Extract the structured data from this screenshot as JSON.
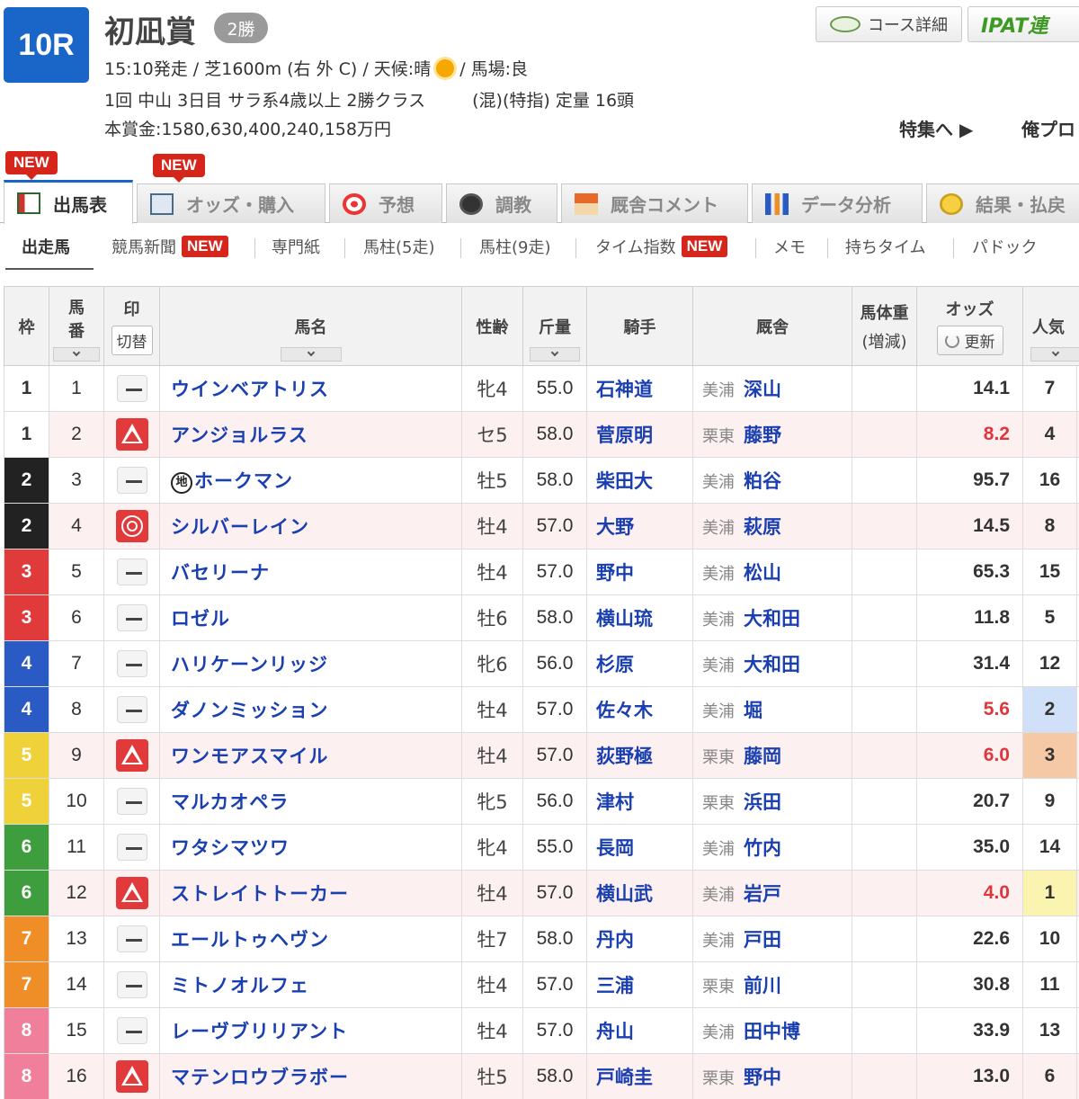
{
  "race": {
    "number": "10R",
    "name": "初凪賞",
    "grade": "2勝",
    "start_time": "15:10発走 / 芝1600m (右 外 C) / 天候:晴",
    "ground": "/ 馬場:良",
    "meeting": "1回 中山 3日目 サラ系4歳以上 2勝クラス",
    "conditions": "(混)(特指) 定量 16頭",
    "prize": "本賞金:1580,630,400,240,158万円"
  },
  "header": {
    "course_detail_label": "コース詳細",
    "ipat_label": "IPAT連",
    "feature_label": "特集へ ▶",
    "ore_label": "俺プロ"
  },
  "new_tag": "NEW",
  "tabs": [
    {
      "label": "出馬表"
    },
    {
      "label": "オッズ・購入"
    },
    {
      "label": "予想"
    },
    {
      "label": "調教"
    },
    {
      "label": "厩舎コメント"
    },
    {
      "label": "データ分析"
    },
    {
      "label": "結果・払戻"
    }
  ],
  "subnav": [
    {
      "label": "出走馬"
    },
    {
      "label": "競馬新聞"
    },
    {
      "label": "専門紙"
    },
    {
      "label": "馬柱(5走)"
    },
    {
      "label": "馬柱(9走)"
    },
    {
      "label": "タイム指数"
    },
    {
      "label": "メモ"
    },
    {
      "label": "持ちタイム"
    },
    {
      "label": "パドック"
    }
  ],
  "table": {
    "headers": {
      "waku": "枠",
      "umaban1": "馬",
      "umaban2": "番",
      "mark": "印",
      "mark_toggle": "切替",
      "name": "馬名",
      "sexage": "性齢",
      "weight": "斤量",
      "jockey": "騎手",
      "stable": "厩舎",
      "bodyweight1": "馬体重",
      "bodyweight2": "(増減)",
      "odds": "オッズ",
      "refresh": "更新",
      "popularity": "人気"
    },
    "chi_mark": "地",
    "rows": [
      {
        "waku": "1",
        "uma": "1",
        "mark": "none",
        "name": "ウインベアトリス",
        "chi": false,
        "sex": "牝4",
        "kin": "55.0",
        "jockey": "石神道",
        "region": "美浦",
        "trainer": "深山",
        "odds": "14.1",
        "hot": false,
        "pop": "7"
      },
      {
        "waku": "1",
        "uma": "2",
        "mark": "triangle",
        "name": "アンジョルラス",
        "chi": false,
        "sex": "セ5",
        "kin": "58.0",
        "jockey": "菅原明",
        "region": "栗東",
        "trainer": "藤野",
        "odds": "8.2",
        "hot": true,
        "pop": "4"
      },
      {
        "waku": "2",
        "uma": "3",
        "mark": "none",
        "name": "ホークマン",
        "chi": true,
        "sex": "牡5",
        "kin": "58.0",
        "jockey": "柴田大",
        "region": "美浦",
        "trainer": "粕谷",
        "odds": "95.7",
        "hot": false,
        "pop": "16"
      },
      {
        "waku": "2",
        "uma": "4",
        "mark": "double",
        "name": "シルバーレイン",
        "chi": false,
        "sex": "牡4",
        "kin": "57.0",
        "jockey": "大野",
        "region": "美浦",
        "trainer": "萩原",
        "odds": "14.5",
        "hot": false,
        "pop": "8"
      },
      {
        "waku": "3",
        "uma": "5",
        "mark": "none",
        "name": "バセリーナ",
        "chi": false,
        "sex": "牡4",
        "kin": "57.0",
        "jockey": "野中",
        "region": "美浦",
        "trainer": "松山",
        "odds": "65.3",
        "hot": false,
        "pop": "15"
      },
      {
        "waku": "3",
        "uma": "6",
        "mark": "none",
        "name": "ロゼル",
        "chi": false,
        "sex": "牡6",
        "kin": "58.0",
        "jockey": "横山琉",
        "region": "美浦",
        "trainer": "大和田",
        "odds": "11.8",
        "hot": false,
        "pop": "5"
      },
      {
        "waku": "4",
        "uma": "7",
        "mark": "none",
        "name": "ハリケーンリッジ",
        "chi": false,
        "sex": "牝6",
        "kin": "56.0",
        "jockey": "杉原",
        "region": "美浦",
        "trainer": "大和田",
        "odds": "31.4",
        "hot": false,
        "pop": "12"
      },
      {
        "waku": "4",
        "uma": "8",
        "mark": "none",
        "name": "ダノンミッション",
        "chi": false,
        "sex": "牡4",
        "kin": "57.0",
        "jockey": "佐々木",
        "region": "美浦",
        "trainer": "堀",
        "odds": "5.6",
        "hot": true,
        "pop": "2"
      },
      {
        "waku": "5",
        "uma": "9",
        "mark": "triangle",
        "name": "ワンモアスマイル",
        "chi": false,
        "sex": "牡4",
        "kin": "57.0",
        "jockey": "荻野極",
        "region": "栗東",
        "trainer": "藤岡",
        "odds": "6.0",
        "hot": true,
        "pop": "3"
      },
      {
        "waku": "5",
        "uma": "10",
        "mark": "none",
        "name": "マルカオペラ",
        "chi": false,
        "sex": "牝5",
        "kin": "56.0",
        "jockey": "津村",
        "region": "栗東",
        "trainer": "浜田",
        "odds": "20.7",
        "hot": false,
        "pop": "9"
      },
      {
        "waku": "6",
        "uma": "11",
        "mark": "none",
        "name": "ワタシマツワ",
        "chi": false,
        "sex": "牝4",
        "kin": "55.0",
        "jockey": "長岡",
        "region": "美浦",
        "trainer": "竹内",
        "odds": "35.0",
        "hot": false,
        "pop": "14"
      },
      {
        "waku": "6",
        "uma": "12",
        "mark": "triangle",
        "name": "ストレイトトーカー",
        "chi": false,
        "sex": "牡4",
        "kin": "57.0",
        "jockey": "横山武",
        "region": "美浦",
        "trainer": "岩戸",
        "odds": "4.0",
        "hot": true,
        "pop": "1"
      },
      {
        "waku": "7",
        "uma": "13",
        "mark": "none",
        "name": "エールトゥヘヴン",
        "chi": false,
        "sex": "牡7",
        "kin": "58.0",
        "jockey": "丹内",
        "region": "美浦",
        "trainer": "戸田",
        "odds": "22.6",
        "hot": false,
        "pop": "10"
      },
      {
        "waku": "7",
        "uma": "14",
        "mark": "none",
        "name": "ミトノオルフェ",
        "chi": false,
        "sex": "牡4",
        "kin": "57.0",
        "jockey": "三浦",
        "region": "栗東",
        "trainer": "前川",
        "odds": "30.8",
        "hot": false,
        "pop": "11"
      },
      {
        "waku": "8",
        "uma": "15",
        "mark": "none",
        "name": "レーヴブリリアント",
        "chi": false,
        "sex": "牡4",
        "kin": "57.0",
        "jockey": "舟山",
        "region": "美浦",
        "trainer": "田中博",
        "odds": "33.9",
        "hot": false,
        "pop": "13"
      },
      {
        "waku": "8",
        "uma": "16",
        "mark": "triangle",
        "name": "マテンロウブラボー",
        "chi": false,
        "sex": "牡5",
        "kin": "58.0",
        "jockey": "戸崎圭",
        "region": "栗東",
        "trainer": "野中",
        "odds": "13.0",
        "hot": false,
        "pop": "6"
      }
    ]
  },
  "colors": {
    "waku": {
      "1": "#ffffff",
      "2": "#222222",
      "3": "#e03a3a",
      "4": "#2a5bc4",
      "5": "#efd23a",
      "6": "#3e9e3e",
      "7": "#ef8e26",
      "8": "#ef7f9b"
    },
    "waku_text": {
      "1": "#333333",
      "2": "#ffffff",
      "3": "#ffffff",
      "4": "#ffffff",
      "5": "#ffffff",
      "6": "#ffffff",
      "7": "#ffffff",
      "8": "#ffffff"
    },
    "pop": {
      "1": "#fbf3b0",
      "2": "#cfe0f8",
      "3": "#f6c9a6"
    },
    "accent": "#1a66c8",
    "new_tag": "#d6251a"
  }
}
